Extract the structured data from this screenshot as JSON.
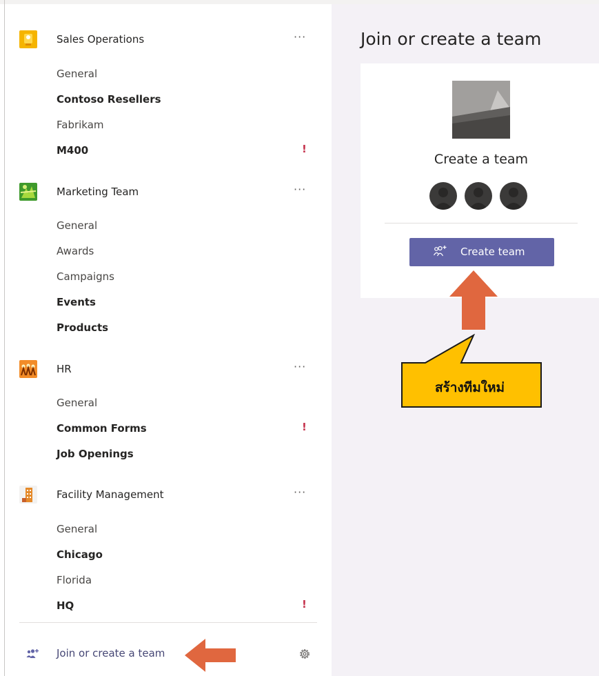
{
  "sidebar": {
    "teams": [
      {
        "name": "Sales Operations",
        "icon": "sales-operations-team-icon",
        "more": "···",
        "channels": [
          {
            "label": "General",
            "bold": false,
            "alert": false
          },
          {
            "label": "Contoso Resellers",
            "bold": true,
            "alert": false
          },
          {
            "label": "Fabrikam",
            "bold": false,
            "alert": false
          },
          {
            "label": "M400",
            "bold": true,
            "alert": true
          }
        ]
      },
      {
        "name": "Marketing Team",
        "icon": "marketing-team-icon",
        "more": "···",
        "channels": [
          {
            "label": "General",
            "bold": false,
            "alert": false
          },
          {
            "label": "Awards",
            "bold": false,
            "alert": false
          },
          {
            "label": "Campaigns",
            "bold": false,
            "alert": false
          },
          {
            "label": "Events",
            "bold": true,
            "alert": false
          },
          {
            "label": "Products",
            "bold": true,
            "alert": false
          }
        ]
      },
      {
        "name": "HR",
        "icon": "hr-team-icon",
        "more": "···",
        "channels": [
          {
            "label": "General",
            "bold": false,
            "alert": false
          },
          {
            "label": "Common Forms",
            "bold": true,
            "alert": true
          },
          {
            "label": "Job Openings",
            "bold": true,
            "alert": false
          }
        ]
      },
      {
        "name": "Facility Management",
        "icon": "facility-management-team-icon",
        "more": "···",
        "channels": [
          {
            "label": "General",
            "bold": false,
            "alert": false
          },
          {
            "label": "Chicago",
            "bold": true,
            "alert": false
          },
          {
            "label": "Florida",
            "bold": false,
            "alert": false
          },
          {
            "label": "HQ",
            "bold": true,
            "alert": true
          }
        ]
      }
    ],
    "alert_mark": "!",
    "join_label": "Join or create a team"
  },
  "main": {
    "title": "Join or create a team",
    "card_title": "Create a team",
    "create_button_label": "Create team"
  },
  "annotation": {
    "callout_text": "สร้างทีมใหม่"
  },
  "colors": {
    "accent": "#6264a7",
    "alert": "#c4314b",
    "annotation_arrow": "#e0673f",
    "callout_fill": "#ffc000"
  }
}
